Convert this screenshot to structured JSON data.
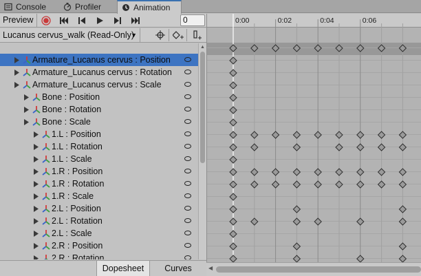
{
  "tabs": [
    {
      "label": "Console",
      "icon": "console-icon",
      "active": false
    },
    {
      "label": "Profiler",
      "icon": "profiler-icon",
      "active": false
    },
    {
      "label": "Animation",
      "icon": "animation-clock-icon",
      "active": true
    }
  ],
  "toolbar": {
    "preview_label": "Preview",
    "frame_value": "0"
  },
  "clip": {
    "name": "Lucanus cervus_walk (Read-Only)"
  },
  "properties": [
    {
      "label": "Armature_Lucanus cervus : Position",
      "indent": 0,
      "selected": true,
      "keys": [
        0
      ]
    },
    {
      "label": "Armature_Lucanus cervus : Rotation",
      "indent": 0,
      "selected": false,
      "keys": [
        0
      ]
    },
    {
      "label": "Armature_Lucanus cervus : Scale",
      "indent": 0,
      "selected": false,
      "keys": [
        0
      ]
    },
    {
      "label": "Bone : Position",
      "indent": 1,
      "selected": false,
      "keys": [
        0
      ]
    },
    {
      "label": "Bone : Rotation",
      "indent": 1,
      "selected": false,
      "keys": [
        0
      ]
    },
    {
      "label": "Bone : Scale",
      "indent": 1,
      "selected": false,
      "keys": [
        0
      ]
    },
    {
      "label": "1.L : Position",
      "indent": 2,
      "selected": false,
      "keys": [
        0,
        1,
        2,
        3,
        4,
        5,
        6,
        7,
        8
      ]
    },
    {
      "label": "1.L : Rotation",
      "indent": 2,
      "selected": false,
      "keys": [
        0,
        1,
        3,
        5,
        6,
        7,
        8
      ]
    },
    {
      "label": "1.L : Scale",
      "indent": 2,
      "selected": false,
      "keys": [
        0
      ]
    },
    {
      "label": "1.R : Position",
      "indent": 2,
      "selected": false,
      "keys": [
        0,
        1,
        2,
        3,
        4,
        5,
        6,
        7,
        8
      ]
    },
    {
      "label": "1.R : Rotation",
      "indent": 2,
      "selected": false,
      "keys": [
        0,
        1,
        2,
        3,
        4,
        5,
        6,
        7,
        8
      ]
    },
    {
      "label": "1.R : Scale",
      "indent": 2,
      "selected": false,
      "keys": [
        0
      ]
    },
    {
      "label": "2.L : Position",
      "indent": 2,
      "selected": false,
      "keys": [
        0,
        3,
        8
      ]
    },
    {
      "label": "2.L : Rotation",
      "indent": 2,
      "selected": false,
      "keys": [
        0,
        1,
        3,
        4,
        6,
        8
      ]
    },
    {
      "label": "2.L : Scale",
      "indent": 2,
      "selected": false,
      "keys": [
        0
      ]
    },
    {
      "label": "2.R : Position",
      "indent": 2,
      "selected": false,
      "keys": [
        0,
        3,
        8
      ]
    },
    {
      "label": "2.R : Rotation",
      "indent": 2,
      "selected": false,
      "keys": [
        0,
        3,
        6,
        8
      ]
    }
  ],
  "summary_keys": [
    0,
    1,
    2,
    3,
    4,
    5,
    6,
    7,
    8
  ],
  "timeline": {
    "ticks": [
      "0:00",
      "0:02",
      "0:04",
      "0:06"
    ],
    "major_frames": [
      0,
      2,
      4,
      6
    ],
    "visible_frames": 9
  },
  "bottom_tabs": [
    {
      "label": "Dopesheet",
      "active": true
    },
    {
      "label": "Curves",
      "active": false
    }
  ],
  "colors": {
    "selected_row": "#3d74c2",
    "record_red": "#c93a3a",
    "axis_red": "#d23b3b",
    "axis_green": "#3fa03f",
    "axis_blue": "#3a63c9",
    "playhead": "#ffffff",
    "key_fill": "#9a9a9a"
  }
}
